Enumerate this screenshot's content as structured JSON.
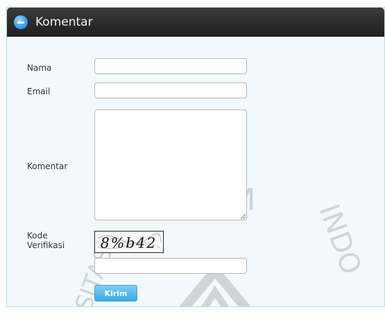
{
  "header": {
    "title": "Komentar",
    "icon": "collapse-minus-icon"
  },
  "form": {
    "nama_label": "Nama",
    "email_label": "Email",
    "komentar_label": "Komentar",
    "kode_label_line1": "Kode",
    "kode_label_line2": "Verifikasi",
    "captcha_text": "8%b42",
    "submit_label": "Kirim"
  },
  "watermark": {
    "text_left": "ISLAM",
    "text_right": "INDO",
    "text_bottom": "SITAS"
  },
  "colors": {
    "header_bg": "#2a2a2a",
    "panel_bg": "#f2f9fd",
    "button_bg": "#39a8e0"
  }
}
